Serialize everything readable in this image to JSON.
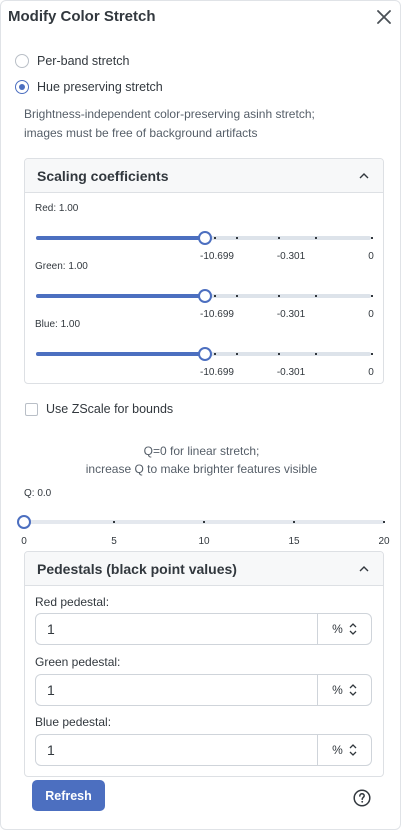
{
  "dialog": {
    "title": "Modify Color Stretch"
  },
  "icons": {
    "close": "close-icon",
    "collapse": "chevron-up-icon",
    "unit_stepper": "chevron-up-down-icon",
    "help": "help-icon"
  },
  "stretch_options": [
    {
      "label": "Per-band stretch",
      "checked": false
    },
    {
      "label": "Hue preserving stretch",
      "checked": true
    }
  ],
  "description": {
    "line1": "Brightness-independent color-preserving asinh stretch;",
    "line2": "images must be free of background artifacts"
  },
  "scaling": {
    "title": "Scaling coefficients",
    "sliders": [
      {
        "label": "Red: 1.00",
        "fraction": 0.503,
        "ticks": [
          "-10.699",
          "-0.301",
          "0"
        ]
      },
      {
        "label": "Green: 1.00",
        "fraction": 0.503,
        "ticks": [
          "-10.699",
          "-0.301",
          "0"
        ]
      },
      {
        "label": "Blue: 1.00",
        "fraction": 0.503,
        "ticks": [
          "-10.699",
          "-0.301",
          "0"
        ]
      }
    ]
  },
  "zscale": {
    "label": "Use ZScale for bounds",
    "checked": false
  },
  "q_note": {
    "line1": "Q=0 for linear stretch;",
    "line2": "increase Q to make brighter features visible"
  },
  "q_slider": {
    "label": "Q: 0.0",
    "value": 0,
    "min": 0,
    "max": 20,
    "ticks": [
      "0",
      "5",
      "10",
      "15",
      "20"
    ]
  },
  "pedestals": {
    "title": "Pedestals (black point values)",
    "fields": [
      {
        "label": "Red pedestal:",
        "value": "1",
        "unit": "%"
      },
      {
        "label": "Green pedestal:",
        "value": "1",
        "unit": "%"
      },
      {
        "label": "Blue pedestal:",
        "value": "1",
        "unit": "%"
      }
    ]
  },
  "buttons": {
    "refresh": "Refresh"
  },
  "colors": {
    "accent": "#4c6fc0",
    "track": "#dde3ea",
    "text": "#32383e"
  }
}
